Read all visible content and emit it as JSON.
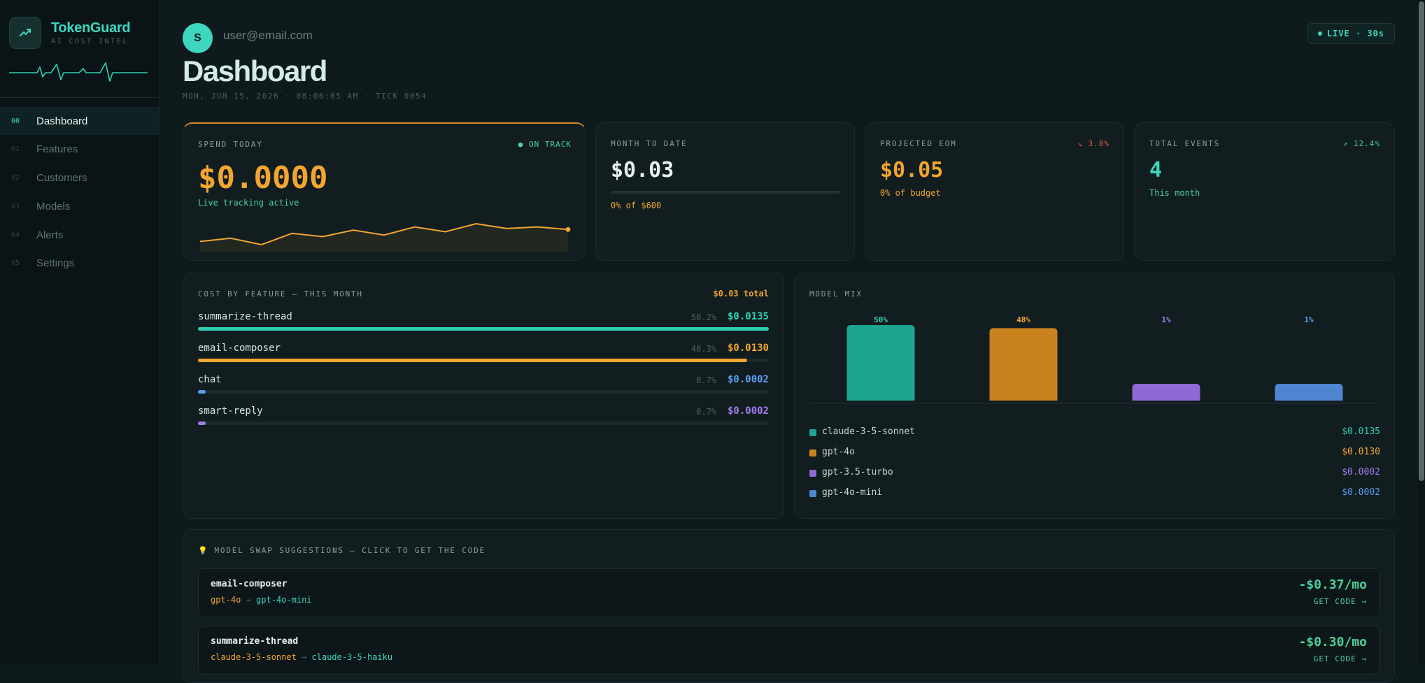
{
  "brand": {
    "name": "TokenGuard",
    "subtitle": "AI COST INTEL",
    "logo_icon": "trending-up-icon"
  },
  "nav": {
    "items": [
      {
        "num": "00",
        "label": "Dashboard",
        "active": true
      },
      {
        "num": "01",
        "label": "Features",
        "active": false
      },
      {
        "num": "02",
        "label": "Customers",
        "active": false
      },
      {
        "num": "03",
        "label": "Models",
        "active": false
      },
      {
        "num": "04",
        "label": "Alerts",
        "active": false
      },
      {
        "num": "05",
        "label": "Settings",
        "active": false
      }
    ]
  },
  "header": {
    "avatar_initial": "S",
    "user_email": "user@email.com",
    "title": "Dashboard",
    "timestamp": "MON, JUN 15, 2026 · 08:06:05 AM · TICK 0054",
    "live_badge": "LIVE · 30s"
  },
  "kpis": {
    "spend_today": {
      "label": "SPEND TODAY",
      "status": "● ON TRACK",
      "value": "$0.0000",
      "sub": "Live tracking active",
      "sparkline": [
        0.45,
        0.35,
        0.55,
        0.2,
        0.3,
        0.1,
        0.25,
        0.0,
        0.15,
        -0.1,
        0.05,
        0.0,
        0.08
      ]
    },
    "month_to_date": {
      "label": "MONTH TO DATE",
      "value": "$0.03",
      "progress": 0.0,
      "sub": "0% of $600"
    },
    "projected_eom": {
      "label": "PROJECTED EOM",
      "trend": "↘ 3.8%",
      "value": "$0.05",
      "sub": "0% of budget"
    },
    "total_events": {
      "label": "TOTAL EVENTS",
      "trend": "↗ 12.4%",
      "value": "4",
      "sub": "This month"
    }
  },
  "cost_by_feature": {
    "label": "COST BY FEATURE — THIS MONTH",
    "total": "$0.03 total",
    "items": [
      {
        "name": "summarize-thread",
        "pct": "50.2%",
        "cost": "$0.0135",
        "fill": 1.0,
        "color": "#2fcfb2"
      },
      {
        "name": "email-composer",
        "pct": "48.3%",
        "cost": "$0.0130",
        "fill": 0.962,
        "color": "#f2a531"
      },
      {
        "name": "chat",
        "pct": "0.7%",
        "cost": "$0.0002",
        "fill": 0.014,
        "color": "#5b9cf0"
      },
      {
        "name": "smart-reply",
        "pct": "0.7%",
        "cost": "$0.0002",
        "fill": 0.014,
        "color": "#a57cf0"
      }
    ]
  },
  "model_mix": {
    "label": "MODEL MIX",
    "items": [
      {
        "name": "claude-3-5-sonnet",
        "cost": "$0.0135",
        "color": "#1ea590",
        "label_color": "#2fcfb2"
      },
      {
        "name": "gpt-4o",
        "cost": "$0.0130",
        "color": "#c8831e",
        "label_color": "#f2a531"
      },
      {
        "name": "gpt-3.5-turbo",
        "cost": "$0.0002",
        "color": "#8e6ad4",
        "label_color": "#a57cf0"
      },
      {
        "name": "gpt-4o-mini",
        "cost": "$0.0002",
        "color": "#4e86d2",
        "label_color": "#5b9cf0"
      }
    ]
  },
  "chart_data": {
    "type": "bar",
    "categories": [
      "claude-3-5-sonnet",
      "gpt-4o",
      "gpt-3.5-turbo",
      "gpt-4o-mini"
    ],
    "values": [
      50,
      48,
      1,
      1
    ],
    "labels": [
      "50%",
      "48%",
      "1%",
      "1%"
    ],
    "title": "MODEL MIX",
    "xlabel": "",
    "ylabel": "",
    "ylim": [
      0,
      50
    ],
    "grid": false
  },
  "swap": {
    "title": "MODEL SWAP SUGGESTIONS — CLICK TO GET THE CODE",
    "icon": "lightbulb-icon",
    "items": [
      {
        "feature": "email-composer",
        "from": "gpt-4o",
        "to": "gpt-4o-mini",
        "saving": "-$0.37/mo",
        "cta": "GET CODE →"
      },
      {
        "feature": "summarize-thread",
        "from": "claude-3-5-sonnet",
        "to": "claude-3-5-haiku",
        "saving": "-$0.30/mo",
        "cta": "GET CODE →"
      }
    ]
  }
}
